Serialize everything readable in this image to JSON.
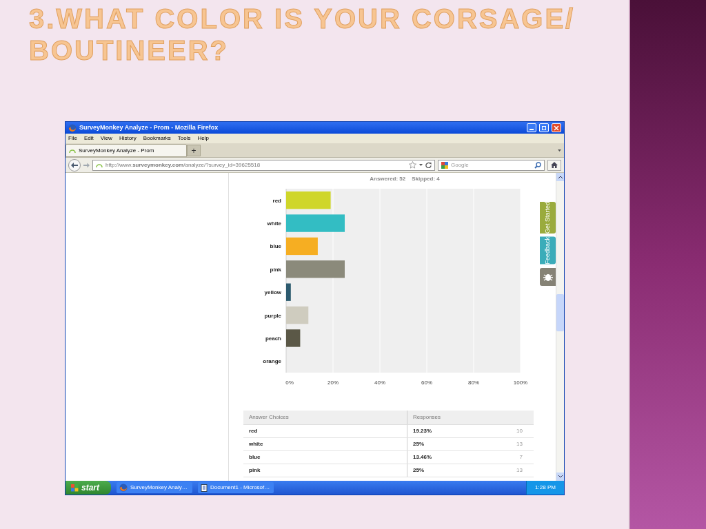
{
  "slide": {
    "title": "3.WHAT COLOR IS YOUR CORSAGE/ BOUTINEER?"
  },
  "browser": {
    "title": "SurveyMonkey Analyze - Prom - Mozilla Firefox",
    "menu": [
      "File",
      "Edit",
      "View",
      "History",
      "Bookmarks",
      "Tools",
      "Help"
    ],
    "tabs": [
      {
        "label": "SurveyMonkey Analyze - Prom",
        "selected": true
      }
    ],
    "new_tab": "+",
    "address": "http://www.**surveymonkey.com**/analyze/?survey_id=39625518",
    "search": {
      "placeholder": "Google"
    }
  },
  "summary": {
    "answered": "Answered: 52",
    "skipped": "Skipped: 4"
  },
  "chart_data": {
    "type": "bar",
    "orientation": "horizontal",
    "categories": [
      "red",
      "white",
      "blue",
      "pink",
      "yellow",
      "purple",
      "peach",
      "orange"
    ],
    "colors": [
      "#cfd62a",
      "#33bdc3",
      "#f6ae22",
      "#8b8a7b",
      "#2c5a6e",
      "#cfccbf",
      "#5b5847",
      "#dddddd"
    ],
    "values": [
      19,
      25,
      13.5,
      25,
      2,
      9.5,
      6,
      0
    ],
    "grid": true,
    "xlim": [
      0,
      100
    ],
    "xticks": [
      {
        "value": 0,
        "label": "0%"
      },
      {
        "value": 20,
        "label": "20%"
      },
      {
        "value": 40,
        "label": "40%"
      },
      {
        "value": 60,
        "label": "60%"
      },
      {
        "value": 80,
        "label": "80%"
      },
      {
        "value": 100,
        "label": "100%"
      }
    ]
  },
  "table": {
    "columns": [
      "Answer Choices",
      "Responses"
    ],
    "rows": [
      {
        "choice": "red",
        "percent": "19.23%",
        "count": "10"
      },
      {
        "choice": "white",
        "percent": "25%",
        "count": "13"
      },
      {
        "choice": "blue",
        "percent": "13.46%",
        "count": "7"
      },
      {
        "choice": "pink",
        "percent": "25%",
        "count": "13"
      }
    ]
  },
  "side_tabs": [
    {
      "kind": "text",
      "label": "Get Started",
      "color": "#9aab3d"
    },
    {
      "kind": "text",
      "label": "Feedback",
      "color": "#3bacb9"
    },
    {
      "kind": "bug",
      "color": "#858275"
    }
  ],
  "taskbar": {
    "start": "start",
    "tasks": [
      {
        "kind": "firefox",
        "label": "SurveyMonkey Analy…"
      },
      {
        "kind": "document",
        "label": "Document1 - Microsof…"
      }
    ],
    "clock": "1:28 PM"
  }
}
